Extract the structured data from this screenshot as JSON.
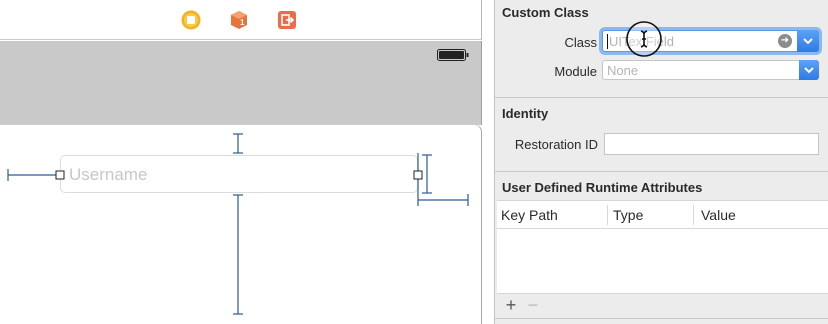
{
  "canvas": {
    "dock_icons": [
      "view-controller-icon",
      "first-responder-icon",
      "exit-icon"
    ],
    "textfield": {
      "placeholder": "Username"
    }
  },
  "inspector": {
    "custom_class": {
      "title": "Custom Class",
      "class_label": "Class",
      "class_placeholder": "UITextField",
      "module_label": "Module",
      "module_value": "None"
    },
    "identity": {
      "title": "Identity",
      "restoration_label": "Restoration ID",
      "restoration_value": ""
    },
    "runtime_attributes": {
      "title": "User Defined Runtime Attributes",
      "columns": [
        "Key Path",
        "Type",
        "Value"
      ],
      "rows": [],
      "add_label": "+",
      "remove_label": "−"
    }
  },
  "colors": {
    "accent": "#3b86ee",
    "constraint": "#2b5c94",
    "dock_orange": "#f5a623",
    "exit_red": "#ec6b4b"
  }
}
